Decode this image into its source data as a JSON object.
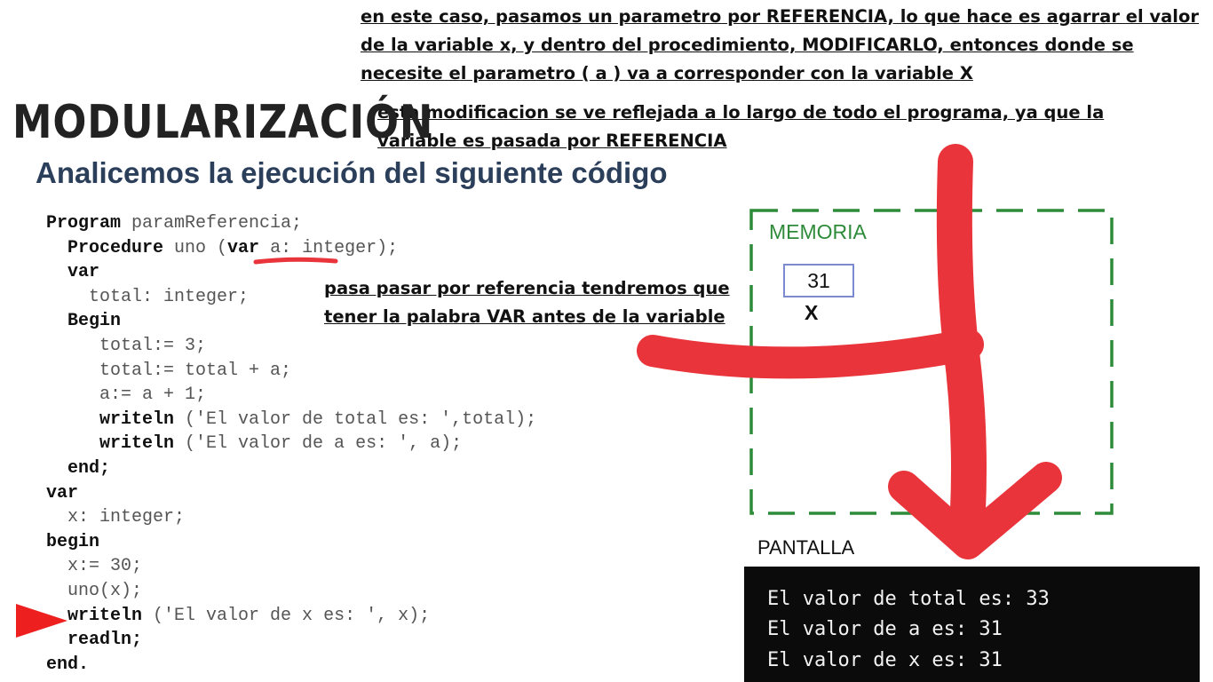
{
  "notes": {
    "reference_explanation": "en este caso, pasamos un parametro por REFERENCIA, lo que hace es agarrar el valor de la variable x, y dentro del procedimiento, MODIFICARLO, entonces donde se necesite el parametro ( a ) va a corresponder con la variable X",
    "program_effect": "esta modificacion se ve reflejada a lo largo de todo el programa, ya que la variable es pasada por REFERENCIA",
    "var_keyword": "pasa pasar por referencia tendremos que tener la palabra VAR antes de la variable"
  },
  "slide": {
    "title": "MODULARIZACIÓN",
    "subtitle": "Analicemos la ejecución del siguiente código"
  },
  "code": {
    "lines": [
      [
        {
          "text": "Program",
          "bold": true
        },
        {
          "text": " paramReferencia;",
          "bold": false
        }
      ],
      [
        {
          "text": "  Procedure",
          "bold": true
        },
        {
          "text": " uno (",
          "bold": false
        },
        {
          "text": "var",
          "bold": true
        },
        {
          "text": " a: integer);",
          "bold": false
        }
      ],
      [
        {
          "text": "  var",
          "bold": true
        }
      ],
      [
        {
          "text": "    total: integer;",
          "bold": false
        }
      ],
      [
        {
          "text": "  Begin",
          "bold": true
        }
      ],
      [
        {
          "text": "     total:= 3;",
          "bold": false
        }
      ],
      [
        {
          "text": "     total:= total + a;",
          "bold": false
        }
      ],
      [
        {
          "text": "     a:= a + 1;",
          "bold": false
        }
      ],
      [
        {
          "text": "     writeln",
          "bold": true
        },
        {
          "text": " ('El valor de total es: ',total);",
          "bold": false
        }
      ],
      [
        {
          "text": "     writeln",
          "bold": true
        },
        {
          "text": " ('El valor de a es: ', a);",
          "bold": false
        }
      ],
      [
        {
          "text": "  end;",
          "bold": true
        }
      ],
      [
        {
          "text": "var",
          "bold": true
        }
      ],
      [
        {
          "text": "  x: integer;",
          "bold": false
        }
      ],
      [
        {
          "text": "begin",
          "bold": true
        }
      ],
      [
        {
          "text": "  x:= 30;",
          "bold": false
        }
      ],
      [
        {
          "text": "  uno(x);",
          "bold": false
        }
      ],
      [
        {
          "text": "  writeln",
          "bold": true
        },
        {
          "text": " ('El valor de x es: ', x);",
          "bold": false
        }
      ],
      [
        {
          "text": "  readln;",
          "bold": true
        }
      ],
      [
        {
          "text": "end.",
          "bold": true
        }
      ]
    ],
    "current_line": 17
  },
  "memory": {
    "label": "MEMORIA",
    "cell_value": "31",
    "cell_name": "X"
  },
  "screen": {
    "label": "PANTALLA",
    "lines": [
      "El valor de total es: 33",
      "El valor de a es: 31",
      "El valor de x es: 31"
    ]
  },
  "colors": {
    "annotation_red": "#e8343a",
    "memory_green": "#2e8b3a",
    "pointer_red": "#ee1f1f",
    "subtitle_blue": "#2b3f5b"
  }
}
